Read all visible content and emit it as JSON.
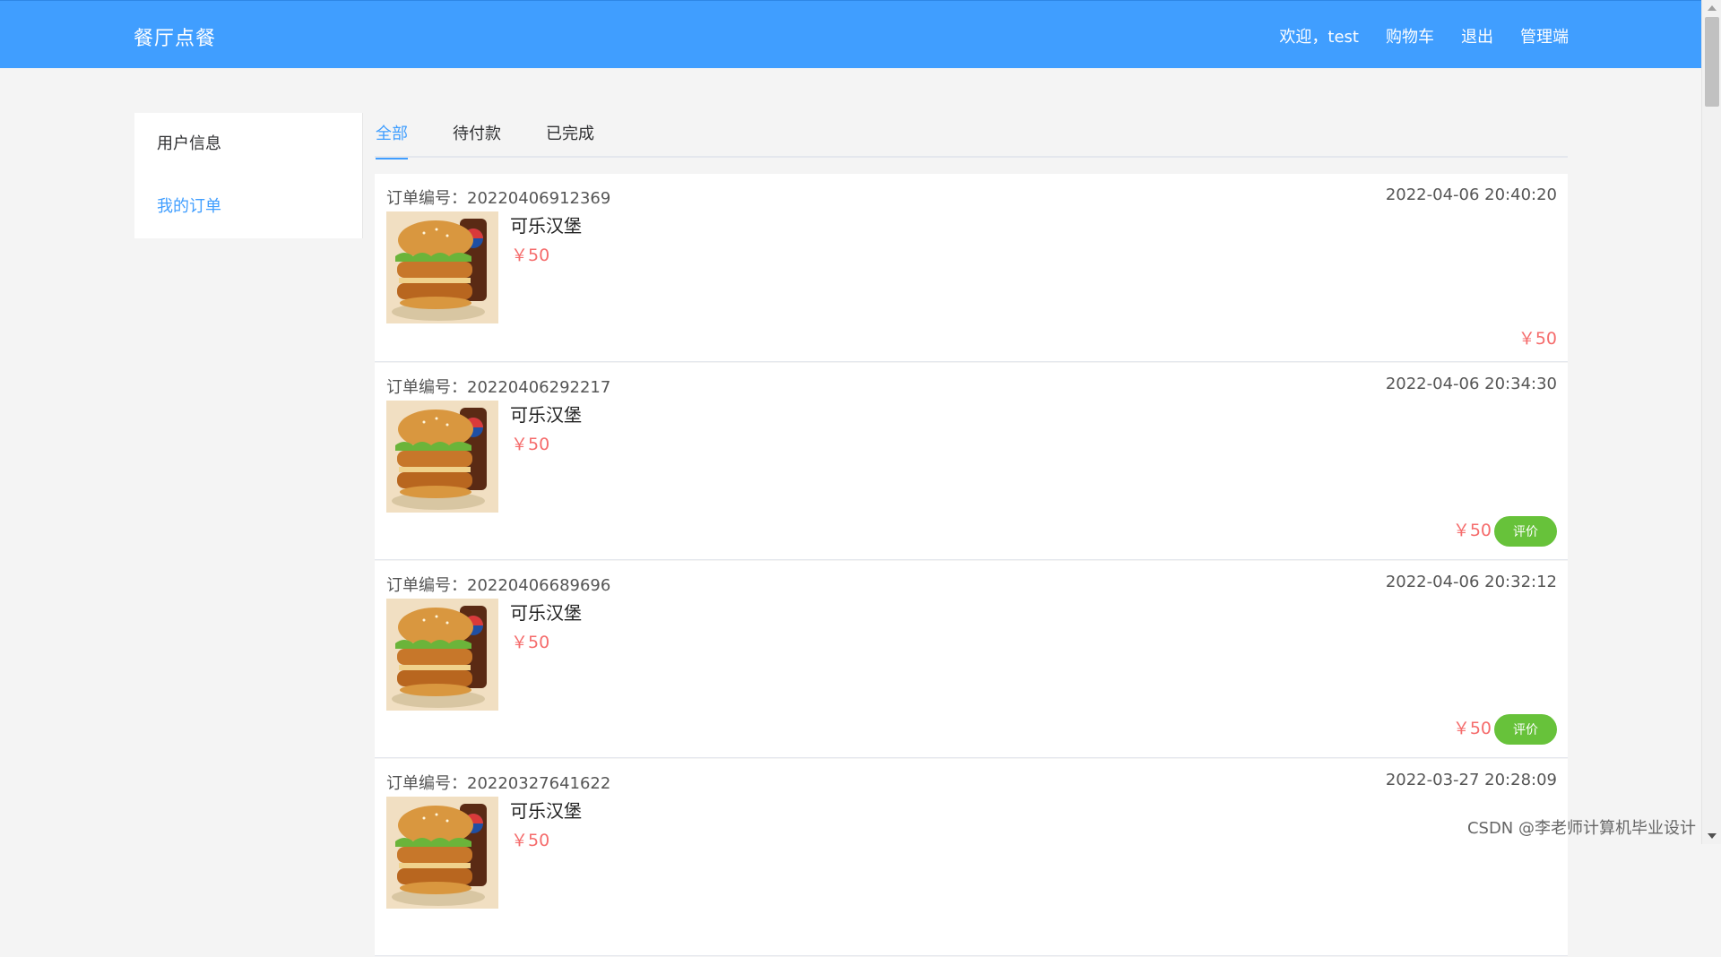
{
  "header": {
    "brand": "餐厅点餐",
    "nav": {
      "welcome": "欢迎，test",
      "cart": "购物车",
      "logout": "退出",
      "admin": "管理端"
    }
  },
  "sidebar": {
    "items": [
      {
        "label": "用户信息"
      },
      {
        "label": "我的订单"
      }
    ]
  },
  "tabs": [
    {
      "label": "全部"
    },
    {
      "label": "待付款"
    },
    {
      "label": "已完成"
    }
  ],
  "orders": [
    {
      "no_label": "订单编号：",
      "no": "20220406912369",
      "time": "2022-04-06 20:40:20",
      "item": {
        "name": "可乐汉堡",
        "price": "￥50"
      },
      "total": "￥50"
    },
    {
      "no_label": "订单编号：",
      "no": "20220406292217",
      "time": "2022-04-06 20:34:30",
      "item": {
        "name": "可乐汉堡",
        "price": "￥50"
      },
      "total": "￥50",
      "action": "评价"
    },
    {
      "no_label": "订单编号：",
      "no": "20220406689696",
      "time": "2022-04-06 20:32:12",
      "item": {
        "name": "可乐汉堡",
        "price": "￥50"
      },
      "total": "￥50",
      "action": "评价"
    },
    {
      "no_label": "订单编号：",
      "no": "20220327641622",
      "time": "2022-03-27 20:28:09",
      "item": {
        "name": "可乐汉堡",
        "price": "￥50"
      }
    }
  ],
  "watermark": "CSDN @李老师计算机毕业设计",
  "colors": {
    "primary": "#409eff",
    "price": "#f56c6c",
    "success": "#67c23a"
  }
}
